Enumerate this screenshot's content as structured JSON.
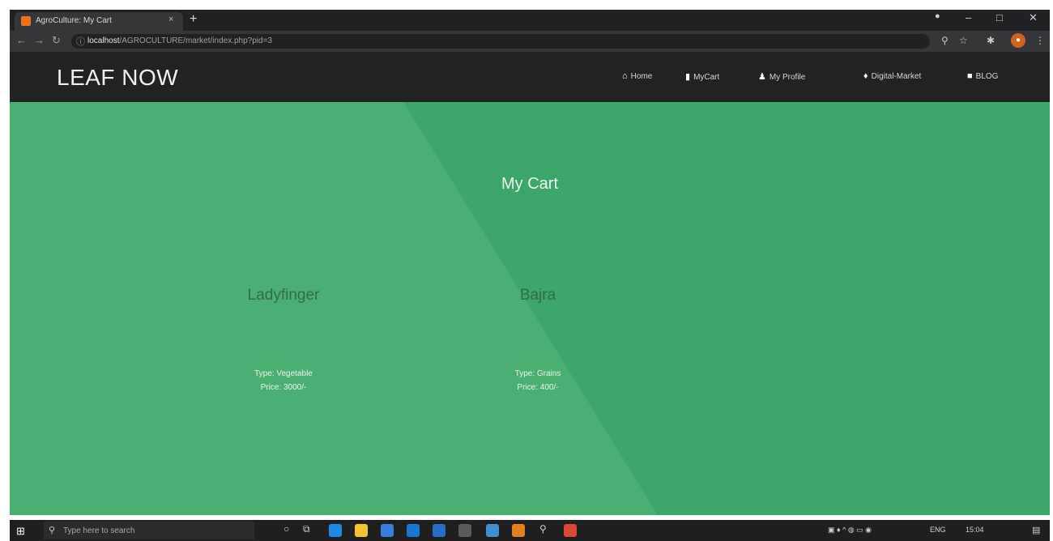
{
  "browser": {
    "tab_title": "AgroCulture: My Cart",
    "tab_close": "×",
    "new_tab": "+",
    "url_host": "localhost",
    "url_path": "/AGROCULTURE/market/index.php?pid=3",
    "minimize": "–",
    "maximize": "□",
    "close": "✕"
  },
  "navbar": {
    "brand": "LEAF NOW",
    "links": [
      {
        "label": "Home",
        "icon": "home-icon"
      },
      {
        "label": "MyCart",
        "icon": "cart-icon"
      },
      {
        "label": "My Profile",
        "icon": "user-icon"
      },
      {
        "label": "Digital-Market",
        "icon": "leaf-icon"
      },
      {
        "label": "BLOG",
        "icon": "comment-icon"
      }
    ]
  },
  "hero": {
    "title": "My Cart",
    "products": [
      {
        "name": "Ladyfinger",
        "type": "Type: Vegetable",
        "price": "Price: 3000/-"
      },
      {
        "name": "Bajra",
        "type": "Type: Grains",
        "price": "Price: 400/-"
      }
    ],
    "colors": {
      "base": "#3da66a",
      "light_triangle": "#4caf72"
    }
  },
  "taskbar": {
    "search_placeholder": "Type here to search",
    "tray_lang": "ENG",
    "tray_time": "15:04"
  }
}
